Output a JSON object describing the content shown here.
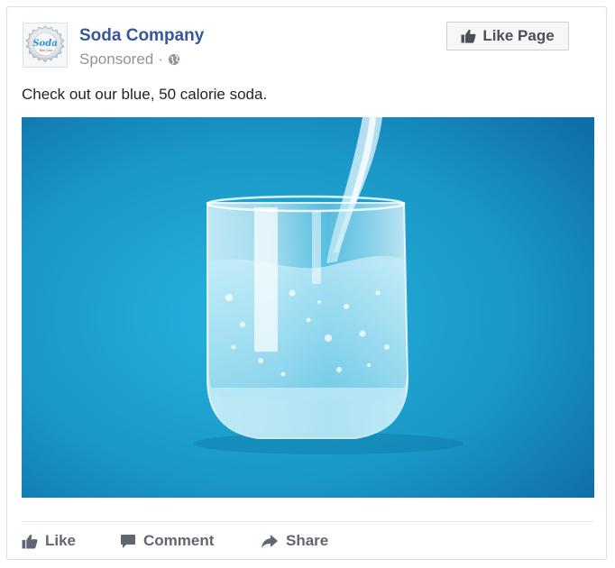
{
  "post": {
    "page_name": "Soda Company",
    "sponsored_label": "Sponsored",
    "separator": "·",
    "like_page_label": "Like Page",
    "text": "Check out our blue, 50 calorie soda.",
    "avatar_text": "Soda",
    "avatar_subtext": "Bee Cola",
    "avatar_icon": "bottle-cap-logo",
    "privacy_icon": "globe-icon"
  },
  "actions": {
    "like_label": "Like",
    "comment_label": "Comment",
    "share_label": "Share"
  },
  "colors": {
    "link_blue": "#365899",
    "muted_gray": "#90949c",
    "action_gray": "#606770",
    "photo_bg": "#1a97c7"
  }
}
